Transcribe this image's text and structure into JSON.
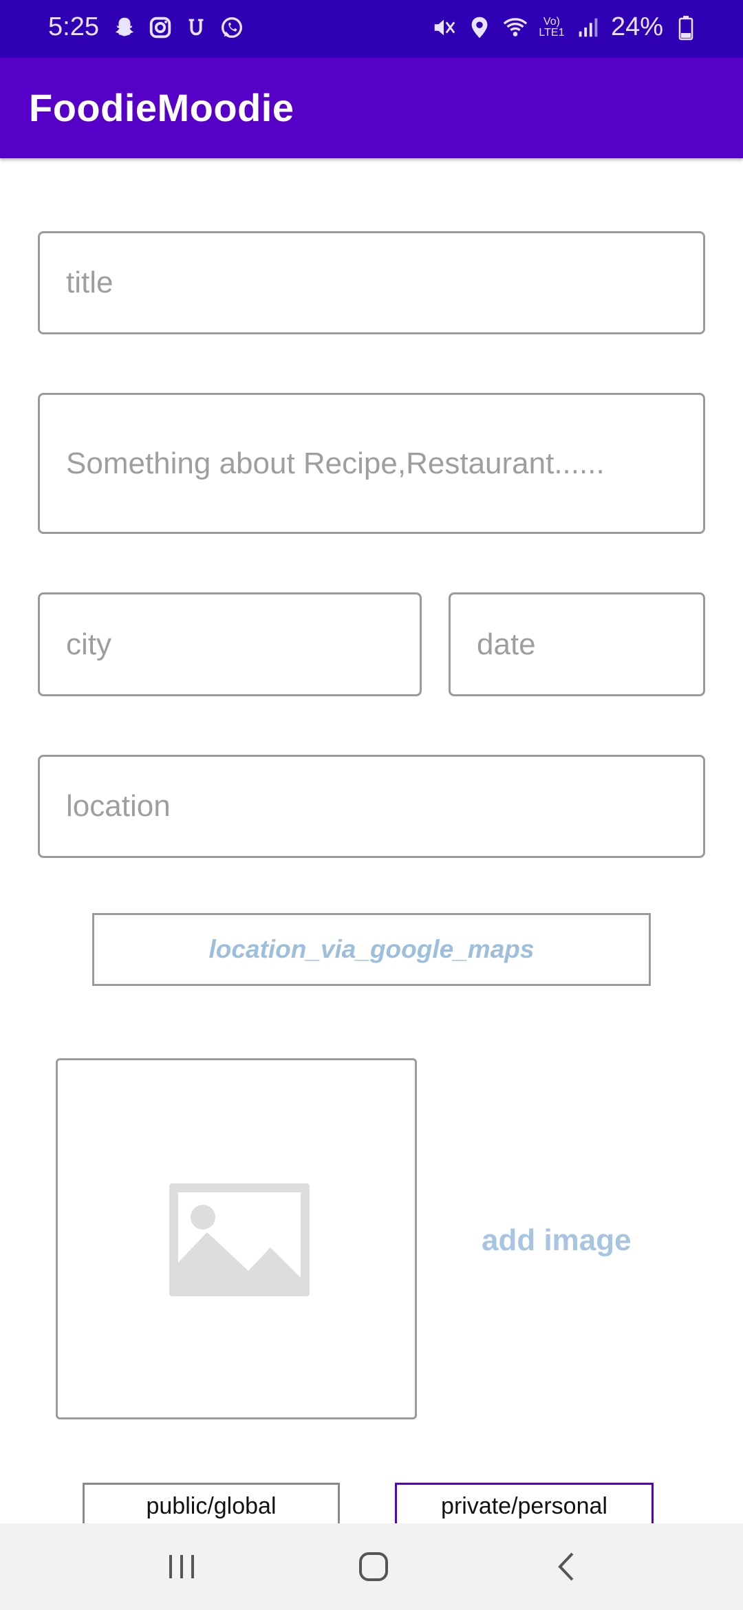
{
  "status_bar": {
    "time": "5:25",
    "battery_percent": "24%",
    "left_icons": [
      "snapchat-icon",
      "instagram-icon",
      "u-app-icon",
      "whatsapp-icon"
    ],
    "right_icons": [
      "mute-icon",
      "location-pin-icon",
      "wifi-icon",
      "volte-icon",
      "signal-icon",
      "battery-icon"
    ],
    "network_label": "Vo) LTE1"
  },
  "app_bar": {
    "title": "FoodieMoodie",
    "color": "#5600c8"
  },
  "form": {
    "title_placeholder": "title",
    "description_placeholder": "Something about Recipe,Restaurant......",
    "city_placeholder": "city",
    "date_placeholder": "date",
    "location_placeholder": "location",
    "maps_button_label": "location_via_google_maps",
    "add_image_label": "add image",
    "image_icon": "image-placeholder-icon",
    "visibility_public_label": "public/global",
    "visibility_private_label": "private/personal"
  },
  "nav_bar": {
    "icons": [
      "recent-apps-icon",
      "home-icon",
      "back-icon"
    ]
  }
}
